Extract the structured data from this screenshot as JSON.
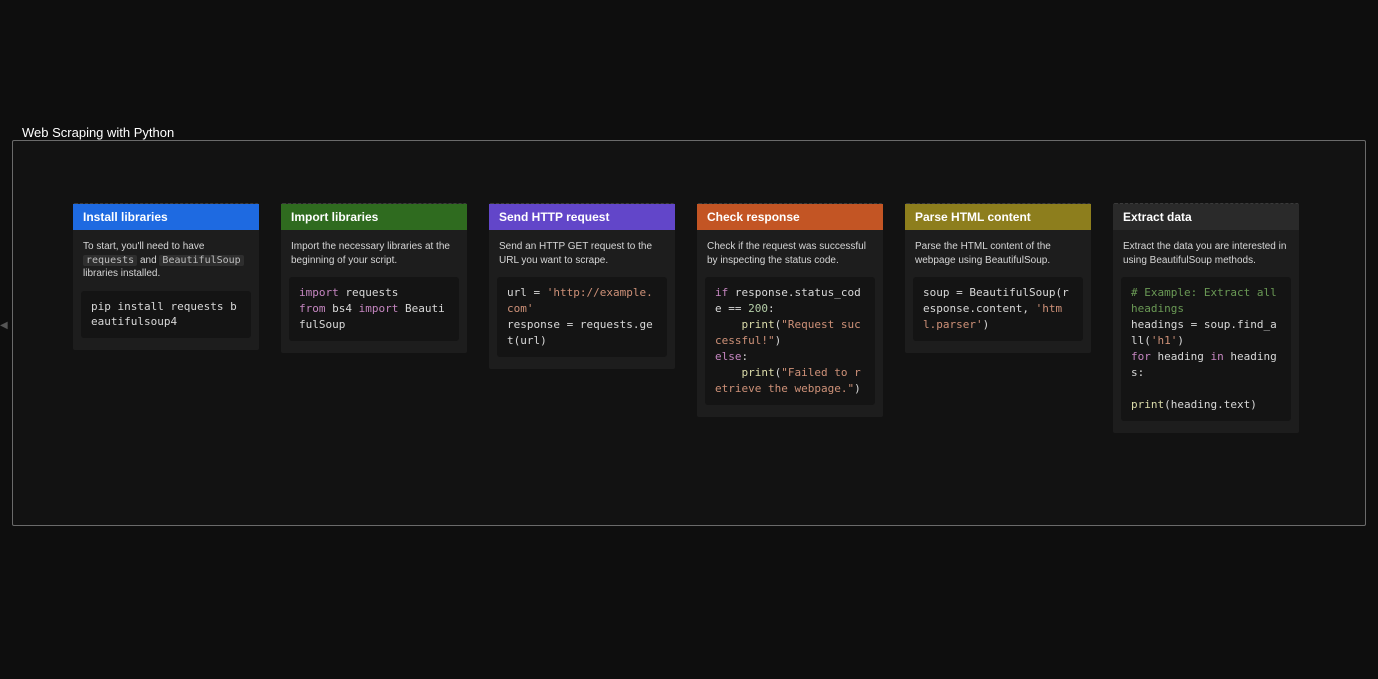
{
  "title": "Web Scraping with Python",
  "cards": [
    {
      "header": "Install libraries",
      "header_color": "blue",
      "desc_pre": "To start, you'll need to have ",
      "chip1": "requests",
      "desc_mid": " and ",
      "chip2": "BeautifulSoup",
      "desc_post": " libraries installed.",
      "code_plain": "pip install requests beautifulsoup4"
    },
    {
      "header": "Import libraries",
      "header_color": "green",
      "desc": "Import the necessary libraries at the beginning of your script.",
      "code_tokens": [
        {
          "t": "kw",
          "v": "import"
        },
        {
          "t": "sp"
        },
        {
          "t": "id",
          "v": "requests"
        },
        {
          "t": "nl"
        },
        {
          "t": "kw",
          "v": "from"
        },
        {
          "t": "sp"
        },
        {
          "t": "id",
          "v": "bs4"
        },
        {
          "t": "sp"
        },
        {
          "t": "kw",
          "v": "import"
        },
        {
          "t": "sp"
        },
        {
          "t": "id",
          "v": "BeautifulSoup"
        }
      ]
    },
    {
      "header": "Send HTTP request",
      "header_color": "purple",
      "desc": "Send an HTTP GET request to the URL you want to scrape.",
      "code_tokens": [
        {
          "t": "id",
          "v": "url = "
        },
        {
          "t": "str",
          "v": "'http://example.com'"
        },
        {
          "t": "nl"
        },
        {
          "t": "id",
          "v": "response = requests.get(url)"
        }
      ]
    },
    {
      "header": "Check response",
      "header_color": "orange",
      "desc": "Check if the request was successful by inspecting the status code.",
      "code_tokens": [
        {
          "t": "kw",
          "v": "if"
        },
        {
          "t": "sp"
        },
        {
          "t": "id",
          "v": "response.status_code == "
        },
        {
          "t": "num",
          "v": "200"
        },
        {
          "t": "id",
          "v": ":"
        },
        {
          "t": "nl"
        },
        {
          "t": "id",
          "v": "    "
        },
        {
          "t": "fn",
          "v": "print"
        },
        {
          "t": "id",
          "v": "("
        },
        {
          "t": "str",
          "v": "\"Request successful!\""
        },
        {
          "t": "id",
          "v": ")"
        },
        {
          "t": "nl"
        },
        {
          "t": "kw",
          "v": "else"
        },
        {
          "t": "id",
          "v": ":"
        },
        {
          "t": "nl"
        },
        {
          "t": "id",
          "v": "    "
        },
        {
          "t": "fn",
          "v": "print"
        },
        {
          "t": "id",
          "v": "("
        },
        {
          "t": "str",
          "v": "\"Failed to retrieve the webpage.\""
        },
        {
          "t": "id",
          "v": ")"
        }
      ]
    },
    {
      "header": "Parse HTML content",
      "header_color": "olive",
      "desc": "Parse the HTML content of the webpage using BeautifulSoup.",
      "code_tokens": [
        {
          "t": "id",
          "v": "soup = BeautifulSoup(response.content, "
        },
        {
          "t": "str",
          "v": "'html.parser'"
        },
        {
          "t": "id",
          "v": ")"
        }
      ]
    },
    {
      "header": "Extract data",
      "header_color": "dark",
      "desc": "Extract the data you are interested in using BeautifulSoup methods.",
      "code_tokens": [
        {
          "t": "com",
          "v": "# Example: Extract all headings"
        },
        {
          "t": "nl"
        },
        {
          "t": "id",
          "v": "headings = soup.find_all("
        },
        {
          "t": "str",
          "v": "'h1'"
        },
        {
          "t": "id",
          "v": ")"
        },
        {
          "t": "nl"
        },
        {
          "t": "kw",
          "v": "for"
        },
        {
          "t": "sp"
        },
        {
          "t": "id",
          "v": "heading"
        },
        {
          "t": "sp"
        },
        {
          "t": "kw",
          "v": "in"
        },
        {
          "t": "sp"
        },
        {
          "t": "id",
          "v": "headings:"
        },
        {
          "t": "nl"
        },
        {
          "t": "nl"
        },
        {
          "t": "fn",
          "v": "print"
        },
        {
          "t": "id",
          "v": "(heading.text)"
        }
      ]
    }
  ]
}
